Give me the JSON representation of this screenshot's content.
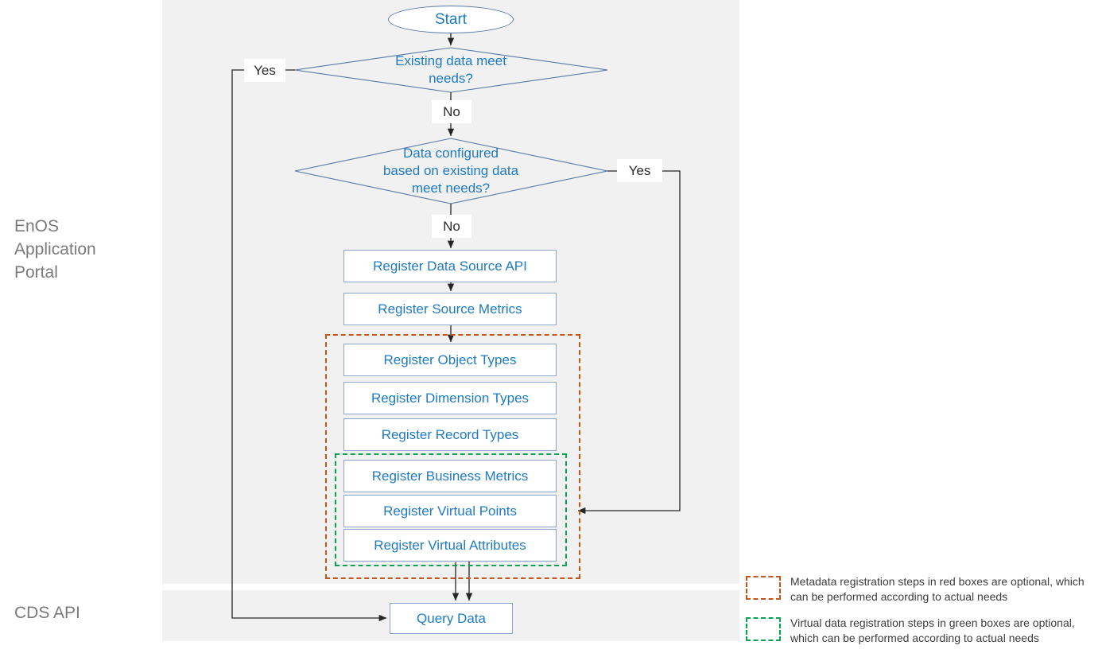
{
  "lanes": [
    {
      "id": "portal",
      "title": "EnOS\nApplication\nPortal"
    },
    {
      "id": "cds",
      "title": "CDS API"
    }
  ],
  "flow": {
    "start": {
      "label": "Start",
      "shape": "terminator"
    },
    "decisions": [
      {
        "id": "d1",
        "label": "Existing data meet\nneeds?",
        "yes": "Yes",
        "no": "No"
      },
      {
        "id": "d2",
        "label": "Data configured\nbased on existing data\nmeet needs?",
        "yes": "Yes",
        "no": "No"
      }
    ],
    "steps": [
      {
        "id": "s1",
        "label": "Register Data Source API"
      },
      {
        "id": "s2",
        "label": "Register Source Metrics"
      },
      {
        "id": "s3",
        "label": "Register Object Types"
      },
      {
        "id": "s4",
        "label": "Register Dimension Types"
      },
      {
        "id": "s5",
        "label": "Register Record Types"
      },
      {
        "id": "s6",
        "label": "Register Business Metrics"
      },
      {
        "id": "s7",
        "label": "Register Virtual Points"
      },
      {
        "id": "s8",
        "label": "Register Virtual Attributes"
      }
    ],
    "query": {
      "label": "Query Data"
    }
  },
  "legend": [
    {
      "color": "#c5561b",
      "swatch": "red-dashed-box",
      "text": "Metadata registration steps in red boxes are optional, which can be performed according to actual needs"
    },
    {
      "color": "#09a550",
      "swatch": "green-dashed-box",
      "text": "Virtual data registration steps in green boxes are optional, which can be performed according to actual needs"
    }
  ],
  "colors": {
    "node_text": "#1f7ac4",
    "node_border": "#8ba4c9",
    "decision_border": "#5a78a8",
    "lane_bg": "#f1f1f1",
    "lane_title": "#7a7a7a",
    "connector": "#262626",
    "red_group": "#c5561b",
    "green_group": "#09a550"
  }
}
